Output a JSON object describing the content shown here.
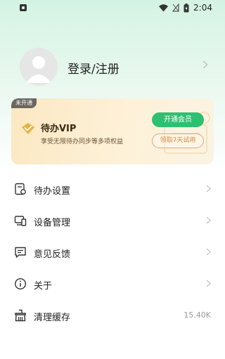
{
  "status_bar": {
    "time": "2:04"
  },
  "profile": {
    "login_text": "登录/注册"
  },
  "vip": {
    "tag": "未开通",
    "title": "待办VIP",
    "description": "享受无限待办同步等多项权益",
    "open_button": "开通会员",
    "trial_button": "领取7天试用"
  },
  "menu": {
    "items": [
      {
        "label": "待办设置",
        "icon": "todo-settings-icon"
      },
      {
        "label": "设备管理",
        "icon": "device-icon"
      },
      {
        "label": "意见反馈",
        "icon": "feedback-icon"
      },
      {
        "label": "关于",
        "icon": "info-icon"
      },
      {
        "label": "清理缓存",
        "icon": "broom-icon",
        "value": "15.40K"
      }
    ]
  },
  "colors": {
    "accent": "#2fbf71",
    "vip_gold": "#e0a773",
    "background_top": "#d4f3e3"
  }
}
